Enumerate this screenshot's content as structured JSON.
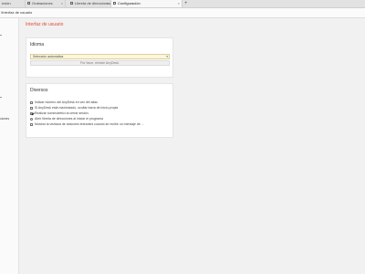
{
  "tabs": [
    {
      "label": "exión",
      "active": false
    },
    {
      "label": "Grabaciones",
      "active": false
    },
    {
      "label": "Libreta de direcciones",
      "active": false
    },
    {
      "label": "Configuración",
      "active": true
    }
  ],
  "tab_close_glyph": "×",
  "tab_add_glyph": "+",
  "address_path": "/Interfaz de usuario",
  "sidebar": {
    "partial_label": "ciones"
  },
  "page_title": "Interfaz de usuario",
  "language": {
    "title": "Idioma",
    "selected": "Selección automática",
    "hint": "Por favor, reinicie AnyDesk."
  },
  "misc": {
    "title": "Diversos",
    "options": [
      {
        "label": "Indicar número del AnyDesk en vez del alias",
        "control": "checkbox",
        "checked": false
      },
      {
        "label": "Si AnyDesk está maximizado, ocultar barra de inicio propia",
        "control": "checkbox",
        "checked": false
      },
      {
        "label": "Realizar commutetrici al cerrar sesión.",
        "control": "checkbox",
        "checked": true
      },
      {
        "label": "Abrir libreta de direcciones al iniciar el programa",
        "control": "radio",
        "checked": false
      },
      {
        "label": "Mostrar la ventana de sesiones entrantes cuando se recibe un mensaje de ...",
        "control": "checkbox",
        "checked": false
      }
    ]
  },
  "colors": {
    "accent": "#e24c3a",
    "select_bg": "#fdf6dc"
  }
}
